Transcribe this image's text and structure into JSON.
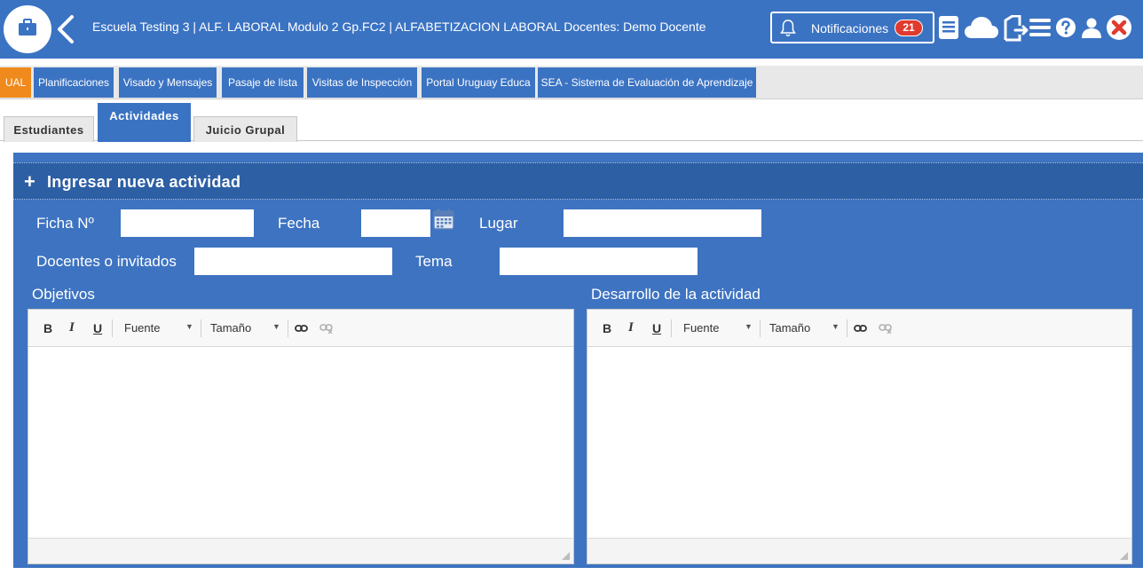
{
  "header": {
    "title": "Escuela Testing 3 | ALF. LABORAL Modulo 2 Gp.FC2 | ALFABETIZACION LABORAL Docentes: Demo Docente",
    "notifications_label": "Notificaciones",
    "notifications_count": "21",
    "colors": {
      "bar": "#3b73c3",
      "badge": "#e03a2e",
      "close": "#e03a2e"
    }
  },
  "nav": {
    "tabs": [
      {
        "label": "UAL",
        "active": true
      },
      {
        "label": "Planificaciones"
      },
      {
        "label": "Visado y Mensajes"
      },
      {
        "label": "Pasaje de lista"
      },
      {
        "label": "Visitas de Inspección"
      },
      {
        "label": "Portal Uruguay Educa"
      },
      {
        "label": "SEA - Sistema de Evaluación de Aprendizaje"
      }
    ]
  },
  "subtabs": {
    "items": [
      {
        "label": "Estudiantes"
      },
      {
        "label": "Actividades",
        "active": true
      },
      {
        "label": "Juicio Grupal"
      }
    ]
  },
  "panel": {
    "plus": "+",
    "title": "Ingresar nueva actividad",
    "fields": {
      "ficha_label": "Ficha Nº",
      "ficha_value": "",
      "fecha_label": "Fecha",
      "fecha_value": "",
      "lugar_label": "Lugar",
      "lugar_value": "",
      "docentes_label": "Docentes o invitados",
      "docentes_value": "",
      "tema_label": "Tema",
      "tema_value": ""
    },
    "editors": [
      {
        "label": "Objetivos",
        "bold": "B",
        "italic": "I",
        "underline": "U",
        "font": "Fuente",
        "size": "Tamaño"
      },
      {
        "label": "Desarrollo de la actividad",
        "bold": "B",
        "italic": "I",
        "underline": "U",
        "font": "Fuente",
        "size": "Tamaño"
      }
    ]
  }
}
